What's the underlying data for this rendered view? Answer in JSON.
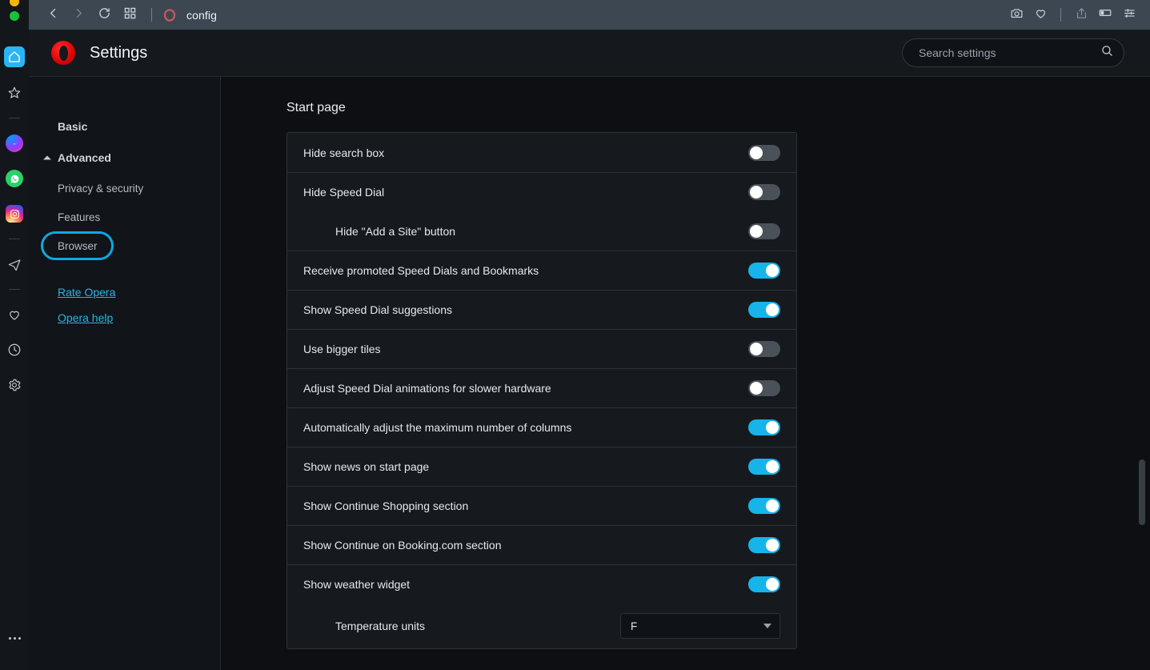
{
  "window": {
    "traffic_lights": [
      "yellow",
      "green"
    ]
  },
  "toolbar": {
    "back_icon": "chevron-left-icon",
    "forward_icon": "chevron-right-icon",
    "reload_icon": "reload-icon",
    "tab_overview_icon": "grid-icon",
    "favicon": "opera-favicon",
    "tab_title": "config",
    "right_icons": [
      {
        "name": "snapshot-icon",
        "label": "Snapshot"
      },
      {
        "name": "heart-icon",
        "label": "Favorites"
      },
      {
        "name": "share-icon",
        "label": "Share"
      },
      {
        "name": "sidebar-panel-icon",
        "label": "Sidebar panel"
      },
      {
        "name": "easy-setup-icon",
        "label": "Easy setup"
      }
    ]
  },
  "rail": {
    "items": [
      {
        "name": "home-icon",
        "label": "Start page",
        "active": true
      },
      {
        "name": "star-icon",
        "label": "Speed Dial"
      },
      {
        "name": "divider-1",
        "label": "divider"
      },
      {
        "name": "messenger-icon",
        "label": "Messenger"
      },
      {
        "name": "whatsapp-icon",
        "label": "WhatsApp"
      },
      {
        "name": "instagram-icon",
        "label": "Instagram"
      },
      {
        "name": "divider-2",
        "label": "divider"
      },
      {
        "name": "telegram-icon",
        "label": "Telegram"
      },
      {
        "name": "divider-3",
        "label": "divider"
      },
      {
        "name": "heart-icon",
        "label": "Favorites"
      },
      {
        "name": "clock-icon",
        "label": "History"
      },
      {
        "name": "gear-icon",
        "label": "Settings"
      }
    ],
    "more_icon": "more-dots-icon"
  },
  "header": {
    "logo": "opera-logo",
    "title": "Settings",
    "search": {
      "placeholder": "Search settings",
      "value": "",
      "icon": "search-icon"
    }
  },
  "nav": {
    "basic": "Basic",
    "advanced": "Advanced",
    "items": [
      {
        "label": "Privacy & security",
        "selected": false
      },
      {
        "label": "Features",
        "selected": false
      },
      {
        "label": "Browser",
        "selected": true,
        "highlighted": true
      }
    ],
    "links": [
      {
        "label": "Rate Opera"
      },
      {
        "label": "Opera help"
      }
    ]
  },
  "content": {
    "section_title": "Start page",
    "rows": [
      {
        "label": "Hide search box",
        "control": "toggle",
        "on": false,
        "indent": false,
        "divider": false
      },
      {
        "label": "Hide Speed Dial",
        "control": "toggle",
        "on": false,
        "indent": false,
        "divider": true
      },
      {
        "label": "Hide \"Add a Site\" button",
        "control": "toggle",
        "on": false,
        "indent": true,
        "divider": false
      },
      {
        "label": "Receive promoted Speed Dials and Bookmarks",
        "control": "toggle",
        "on": true,
        "indent": false,
        "divider": true
      },
      {
        "label": "Show Speed Dial suggestions",
        "control": "toggle",
        "on": true,
        "indent": false,
        "divider": true
      },
      {
        "label": "Use bigger tiles",
        "control": "toggle",
        "on": false,
        "indent": false,
        "divider": true
      },
      {
        "label": "Adjust Speed Dial animations for slower hardware",
        "control": "toggle",
        "on": false,
        "indent": false,
        "divider": true
      },
      {
        "label": "Automatically adjust the maximum number of columns",
        "control": "toggle",
        "on": true,
        "indent": false,
        "divider": true
      },
      {
        "label": "Show news on start page",
        "control": "toggle",
        "on": true,
        "indent": false,
        "divider": true
      },
      {
        "label": "Show Continue Shopping section",
        "control": "toggle",
        "on": true,
        "indent": false,
        "divider": true
      },
      {
        "label": "Show Continue on Booking.com section",
        "control": "toggle",
        "on": true,
        "indent": false,
        "divider": true
      },
      {
        "label": "Show weather widget",
        "control": "toggle",
        "on": true,
        "indent": false,
        "divider": true
      },
      {
        "label": "Temperature units",
        "control": "select",
        "value": "F",
        "indent": true,
        "divider": false
      }
    ]
  },
  "colors": {
    "accent_cyan": "#17b4e9",
    "highlight_ring": "#0fa8e0",
    "opera_red": "#e00606",
    "link": "#2ab4e8",
    "toolbar_bg": "#3c4752",
    "content_bg": "#0d0f12",
    "card_bg": "#161a1f"
  }
}
